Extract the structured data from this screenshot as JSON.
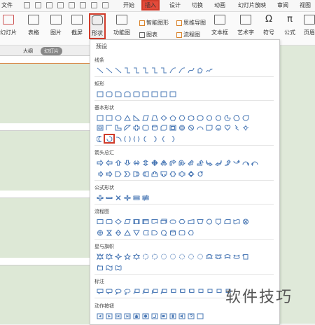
{
  "menubar": {
    "file": "文件",
    "start": "开始",
    "insert": "插入",
    "design": "设计",
    "switch": "切换",
    "animation": "动画",
    "slideshow": "幻灯片放映",
    "review": "审阅",
    "view": "视图"
  },
  "ribbon": {
    "slide": "幻灯片",
    "table": "表格",
    "picture": "图片",
    "screenshot": "截屏",
    "shape": "形状",
    "function_chart": "功能图",
    "smart_graphic": "智能图形",
    "mind_map": "思维导图",
    "chart": "图表",
    "flowchart": "流程图",
    "textbox": "文本框",
    "wordart": "艺术字",
    "symbol": "符号",
    "formula": "公式",
    "header": "页眉"
  },
  "panel": {
    "outline_tab": "大纲",
    "slides_tab": "幻灯片"
  },
  "dropdown": {
    "preset": "预设",
    "categories": {
      "lines": "线条",
      "rect": "矩形",
      "basic": "基本形状",
      "arrows": "箭头总汇",
      "equation": "公式形状",
      "flow": "流程图",
      "stars": "星与旗帜",
      "callouts": "标注",
      "action": "动作按钮"
    },
    "selected_shape": "arc"
  },
  "watermark": "软件技巧"
}
